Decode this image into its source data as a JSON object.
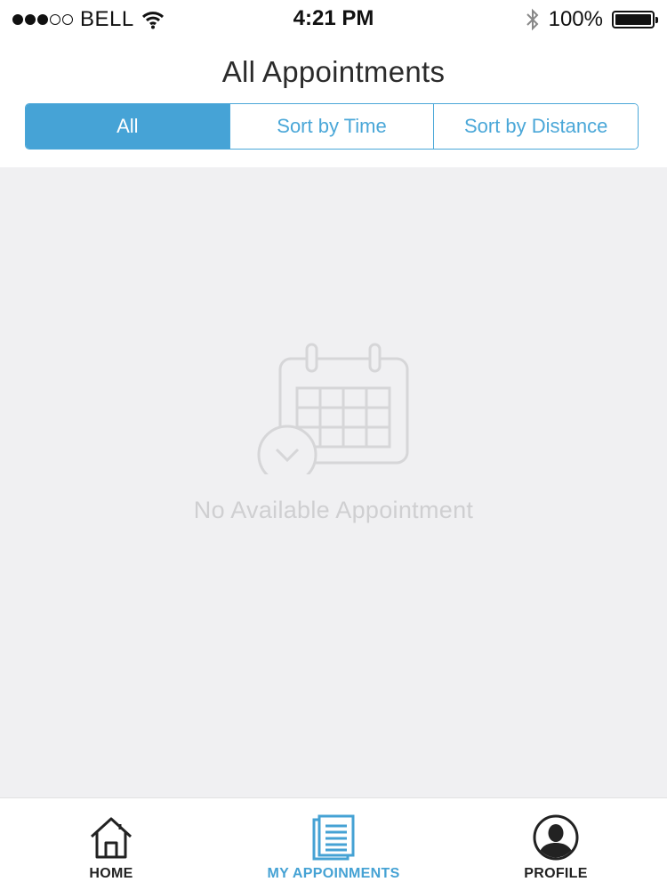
{
  "status_bar": {
    "carrier": "BELL",
    "time": "4:21 PM",
    "battery_percent": "100%",
    "signal_bars_filled": 3,
    "signal_bars_total": 5
  },
  "header": {
    "title": "All Appointments",
    "segments": [
      {
        "label": "All",
        "active": true
      },
      {
        "label": "Sort by Time",
        "active": false
      },
      {
        "label": "Sort by Distance",
        "active": false
      }
    ]
  },
  "empty_state": {
    "icon": "calendar-icon",
    "message": "No Available Appointment"
  },
  "tab_bar": {
    "tabs": [
      {
        "label": "HOME",
        "icon": "home-icon",
        "active": false
      },
      {
        "label": "MY APPOINMENTS",
        "icon": "document-list-icon",
        "active": true
      },
      {
        "label": "PROFILE",
        "icon": "profile-icon",
        "active": false
      }
    ]
  },
  "colors": {
    "accent": "#46a3d6",
    "content_background": "#f0f0f2",
    "empty_state_gray": "#cfcfd1"
  }
}
